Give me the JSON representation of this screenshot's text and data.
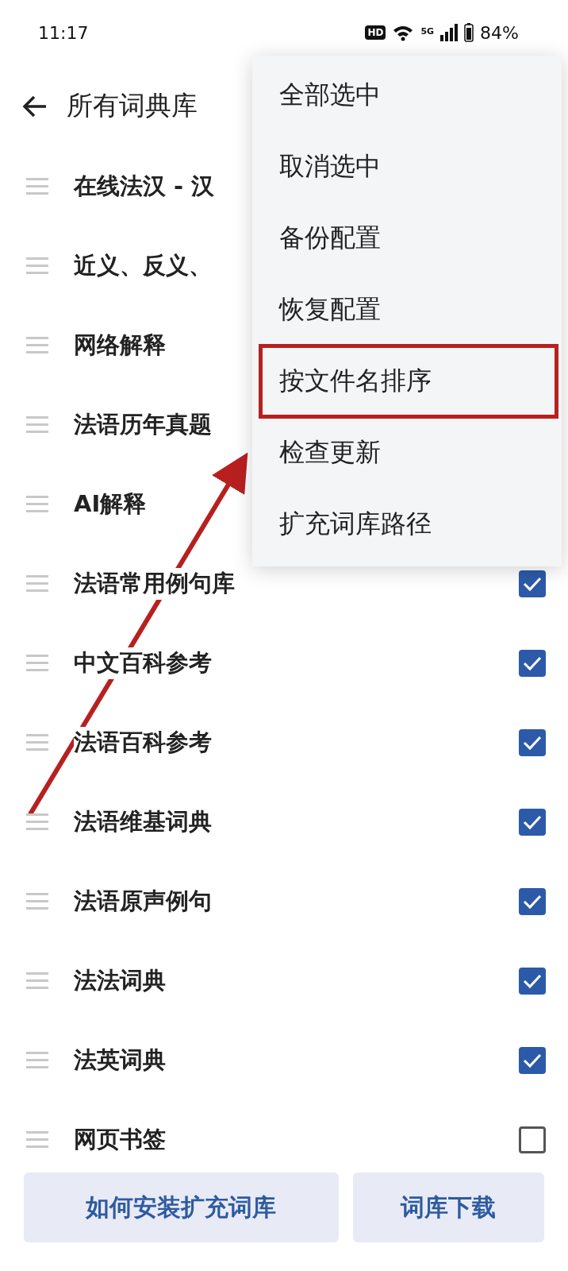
{
  "status_bar": {
    "time": "11:17",
    "hd_badge": "HD",
    "network": "5G",
    "battery": "84%"
  },
  "header": {
    "title": "所有词典库"
  },
  "dictionaries": [
    {
      "name": "在线法汉 - 汉"
    },
    {
      "name": "近义、反义、"
    },
    {
      "name": "网络解释"
    },
    {
      "name": "法语历年真题"
    },
    {
      "name": "AI解释"
    },
    {
      "name": "法语常用例句库",
      "checked": true
    },
    {
      "name": "中文百科参考",
      "checked": true
    },
    {
      "name": "法语百科参考",
      "checked": true
    },
    {
      "name": "法语维基词典",
      "checked": true
    },
    {
      "name": "法语原声例句",
      "checked": true
    },
    {
      "name": "法法词典",
      "checked": true
    },
    {
      "name": "法英词典",
      "checked": true
    },
    {
      "name": "网页书签",
      "checked": false
    }
  ],
  "menu": {
    "items": [
      {
        "label": "全部选中",
        "highlighted": false
      },
      {
        "label": "取消选中",
        "highlighted": false
      },
      {
        "label": "备份配置",
        "highlighted": false
      },
      {
        "label": "恢复配置",
        "highlighted": false
      },
      {
        "label": "按文件名排序",
        "highlighted": true
      },
      {
        "label": "检查更新",
        "highlighted": false
      },
      {
        "label": "扩充词库路径",
        "highlighted": false
      }
    ]
  },
  "buttons": [
    {
      "label": "如何安装扩充词库"
    },
    {
      "label": "词库下载"
    }
  ]
}
